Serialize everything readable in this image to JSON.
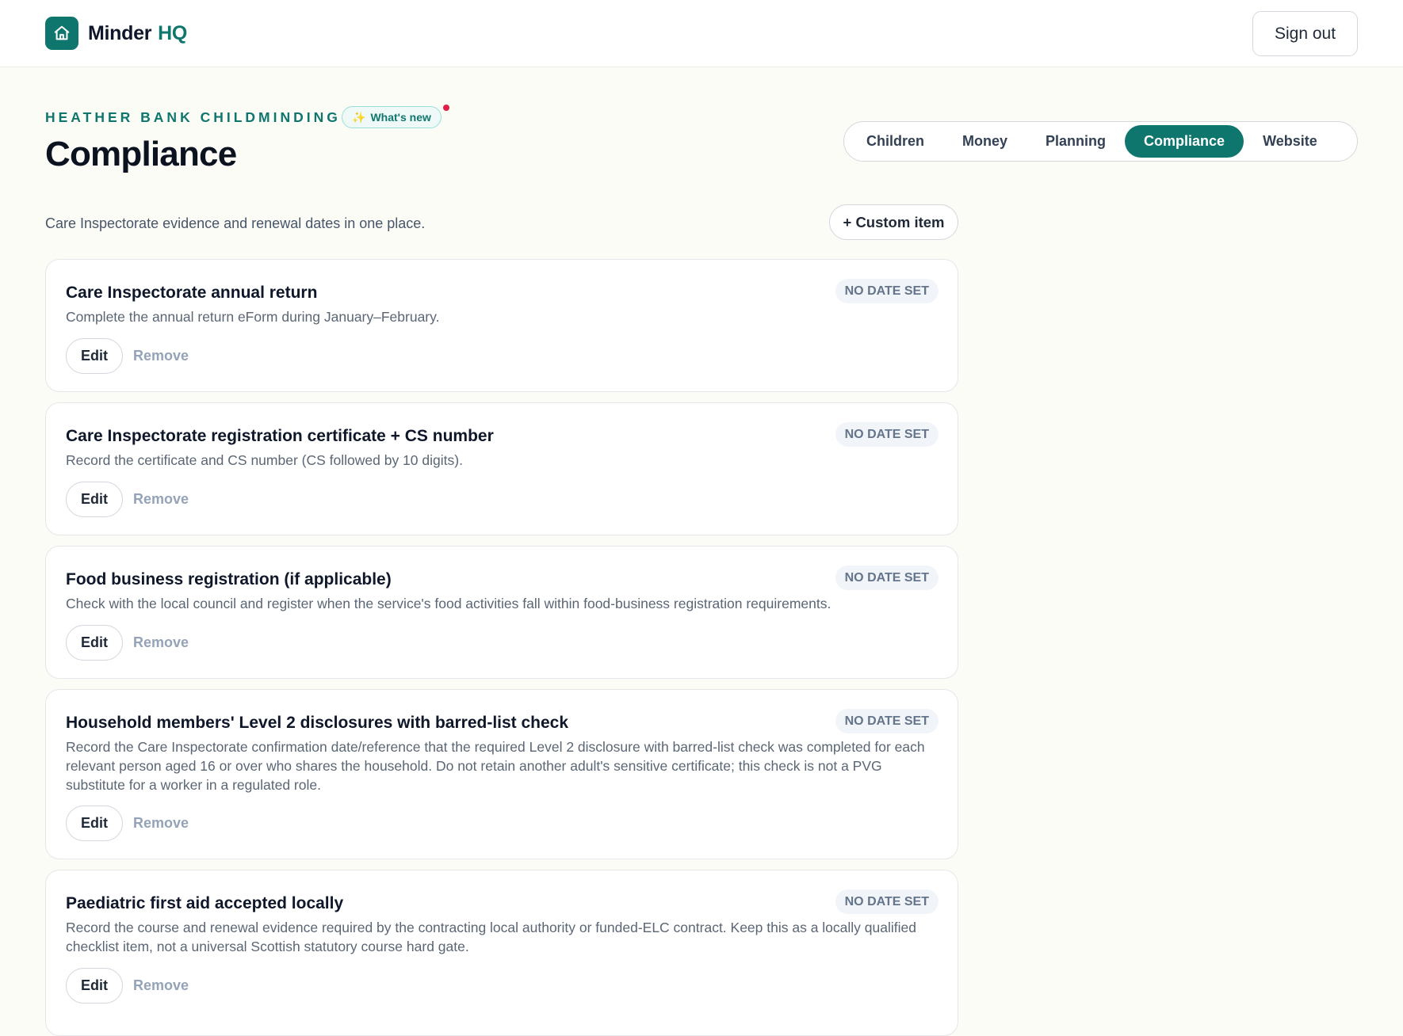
{
  "app": {
    "name": "Minder",
    "suffix": "HQ",
    "logo_icon": "home-icon"
  },
  "header": {
    "sign_out_label": "Sign out"
  },
  "page": {
    "business_name": "HEATHER BANK CHILDMINDING",
    "whats_new_label": "What's new",
    "title": "Compliance",
    "subtitle": "Care Inspectorate evidence and renewal dates in one place.",
    "custom_item_label": "+ Custom item"
  },
  "tabs": [
    {
      "label": "Children",
      "active": false
    },
    {
      "label": "Money",
      "active": false
    },
    {
      "label": "Planning",
      "active": false
    },
    {
      "label": "Compliance",
      "active": true
    },
    {
      "label": "Website",
      "active": false
    }
  ],
  "items": [
    {
      "title": "Care Inspectorate annual return",
      "status": "NO DATE SET",
      "description": "Complete the annual return eForm during January–February.",
      "edit_label": "Edit",
      "remove_label": "Remove"
    },
    {
      "title": "Care Inspectorate registration certificate + CS number",
      "status": "NO DATE SET",
      "description": "Record the certificate and CS number (CS followed by 10 digits).",
      "edit_label": "Edit",
      "remove_label": "Remove"
    },
    {
      "title": "Food business registration (if applicable)",
      "status": "NO DATE SET",
      "description": "Check with the local council and register when the service's food activities fall within food-business registration requirements.",
      "edit_label": "Edit",
      "remove_label": "Remove"
    },
    {
      "title": "Household members' Level 2 disclosures with barred-list check",
      "status": "NO DATE SET",
      "description": "Record the Care Inspectorate confirmation date/reference that the required Level 2 disclosure with barred-list check was completed for each relevant person aged 16 or over who shares the household. Do not retain another adult's sensitive certificate; this check is not a PVG substitute for a worker in a regulated role.",
      "edit_label": "Edit",
      "remove_label": "Remove"
    },
    {
      "title": "Paediatric first aid accepted locally",
      "status": "NO DATE SET",
      "description": "Record the course and renewal evidence required by the contracting local authority or funded-ELC contract. Keep this as a locally qualified checklist item, not a universal Scottish statutory course hard gate.",
      "edit_label": "Edit",
      "remove_label": "Remove"
    }
  ]
}
